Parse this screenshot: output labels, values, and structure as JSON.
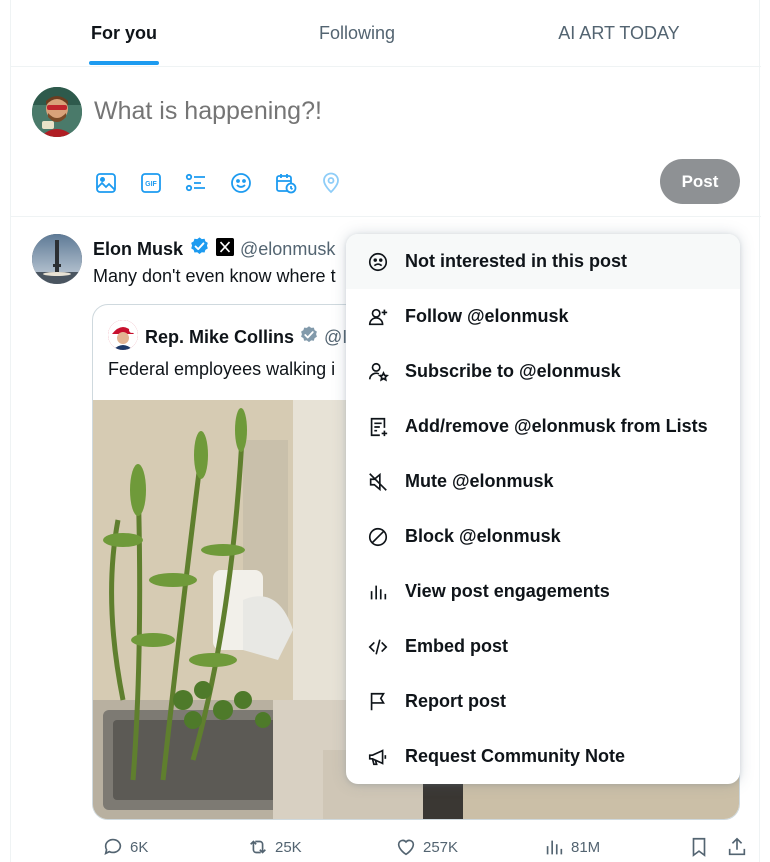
{
  "tabs": [
    {
      "label": "For you",
      "active": true
    },
    {
      "label": "Following",
      "active": false
    },
    {
      "label": "AI ART TODAY",
      "active": false
    }
  ],
  "composer": {
    "placeholder": "What is happening?!",
    "post_label": "Post",
    "icons": [
      "image-icon",
      "gif-icon",
      "poll-icon",
      "emoji-icon",
      "schedule-icon",
      "location-icon"
    ]
  },
  "tweet": {
    "author": "Elon Musk",
    "handle": "@elonmusk",
    "text": "Many don't even know where t",
    "quote": {
      "author": "Rep. Mike Collins",
      "handle": "@I",
      "text": "Federal employees walking i"
    },
    "actions": {
      "replies": "6K",
      "reposts": "25K",
      "likes": "257K",
      "views": "81M"
    }
  },
  "menu": {
    "items": [
      {
        "label": "Not interested in this post",
        "icon": "frown-icon"
      },
      {
        "label": "Follow @elonmusk",
        "icon": "follow-icon"
      },
      {
        "label": "Subscribe to @elonmusk",
        "icon": "subscribe-icon"
      },
      {
        "label": "Add/remove @elonmusk from Lists",
        "icon": "list-icon"
      },
      {
        "label": "Mute @elonmusk",
        "icon": "mute-icon"
      },
      {
        "label": "Block @elonmusk",
        "icon": "block-icon"
      },
      {
        "label": "View post engagements",
        "icon": "engagements-icon"
      },
      {
        "label": "Embed post",
        "icon": "embed-icon"
      },
      {
        "label": "Report post",
        "icon": "flag-icon"
      },
      {
        "label": "Request Community Note",
        "icon": "megaphone-icon"
      }
    ]
  },
  "colors": {
    "accent": "#1d9bf0",
    "text": "#0f1419",
    "muted": "#536471",
    "post_button_disabled": "#8e9194"
  }
}
